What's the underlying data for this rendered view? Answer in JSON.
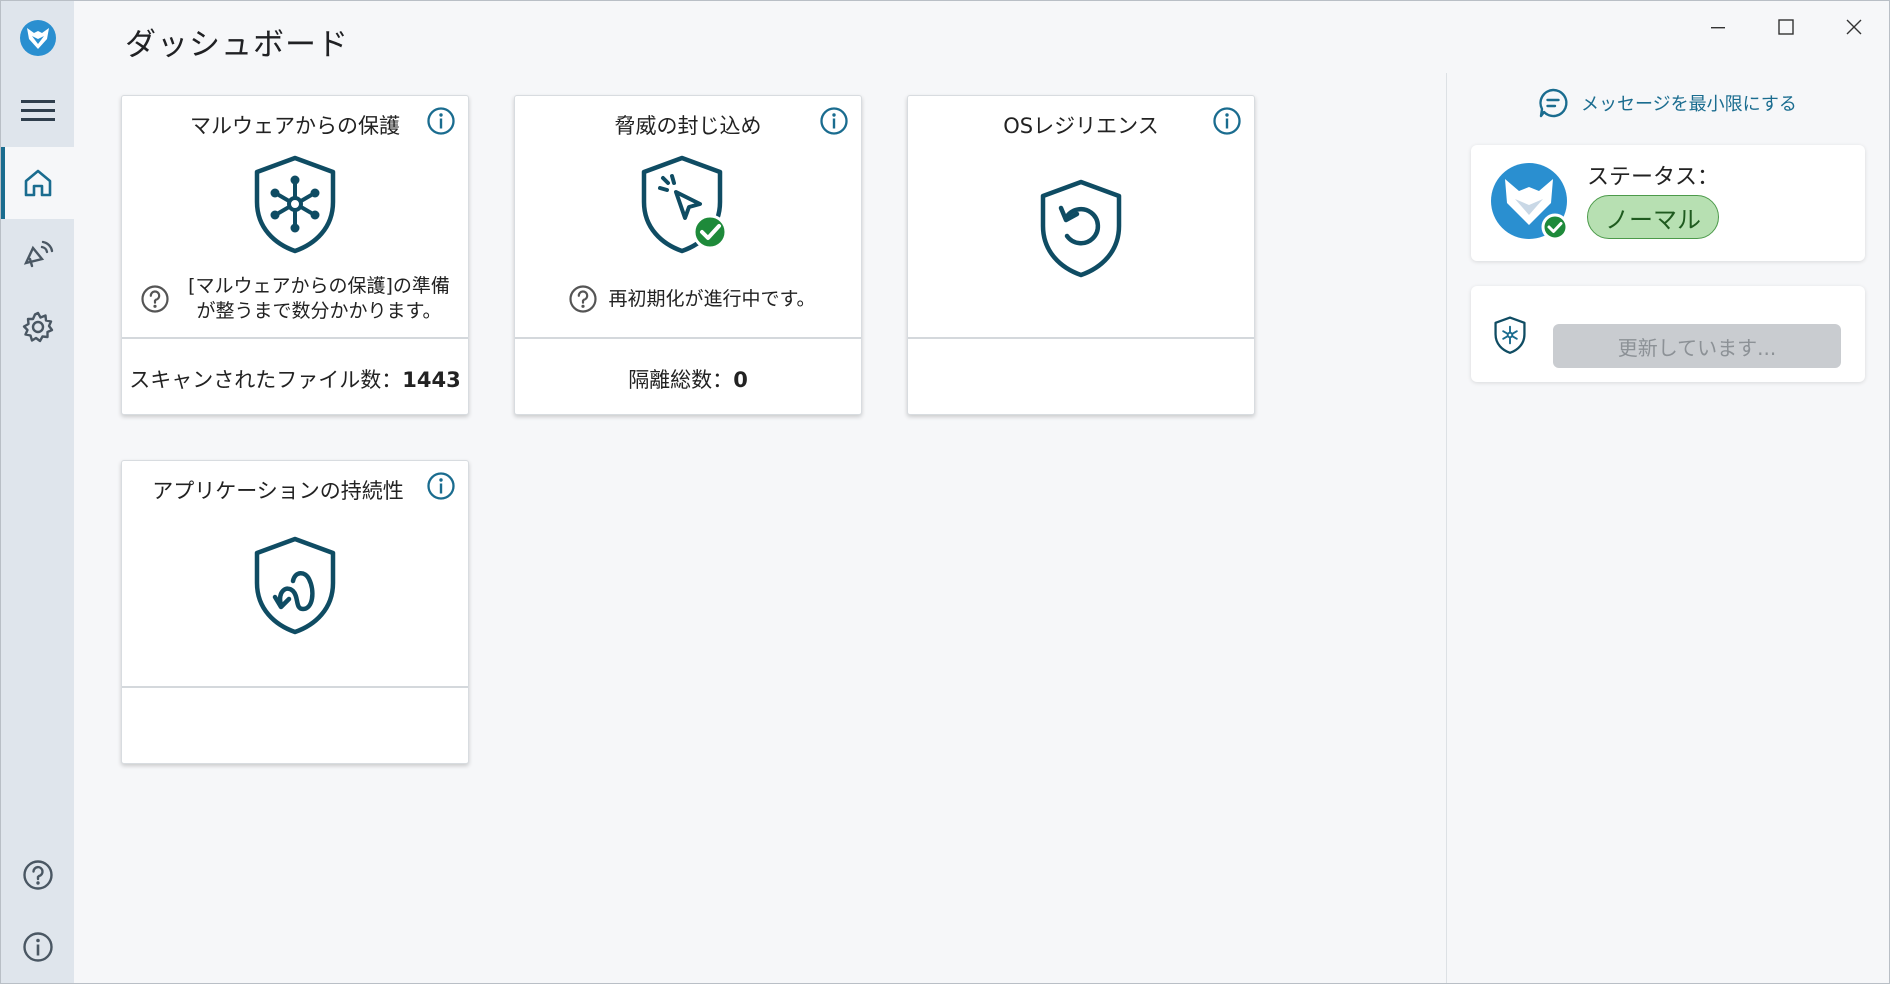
{
  "header": {
    "title": "ダッシュボード"
  },
  "cards": [
    {
      "title": "マルウェアからの保護",
      "note": "[マルウェアからの保護]の準備が整うまで数分かかります。",
      "footer_label": "スキャンされたファイル数：",
      "footer_value": "1443"
    },
    {
      "title": "脅威の封じ込め",
      "note": "再初期化が進行中です。",
      "footer_label": "隔離総数：",
      "footer_value": "0"
    },
    {
      "title": "OSレジリエンス"
    },
    {
      "title": "アプリケーションの持続性"
    }
  ],
  "right_panel": {
    "minimize_messages": "メッセージを最小限にする",
    "status_label": "ステータス：",
    "status_value": "ノーマル",
    "update_button": "更新しています..."
  },
  "colors": {
    "accent": "#1a6c8f",
    "icon_dark": "#0f4c63",
    "sidebar_bg": "#dfe5ec",
    "status_green": "#b7e0b2",
    "check_green": "#1e8a3a"
  },
  "icons": {
    "sidebar": [
      "app-logo",
      "hamburger-menu-icon",
      "home-icon",
      "broadcast-icon",
      "gear-icon",
      "help-icon",
      "info-icon"
    ],
    "window": [
      "minimize-icon",
      "maximize-icon",
      "close-icon"
    ]
  }
}
